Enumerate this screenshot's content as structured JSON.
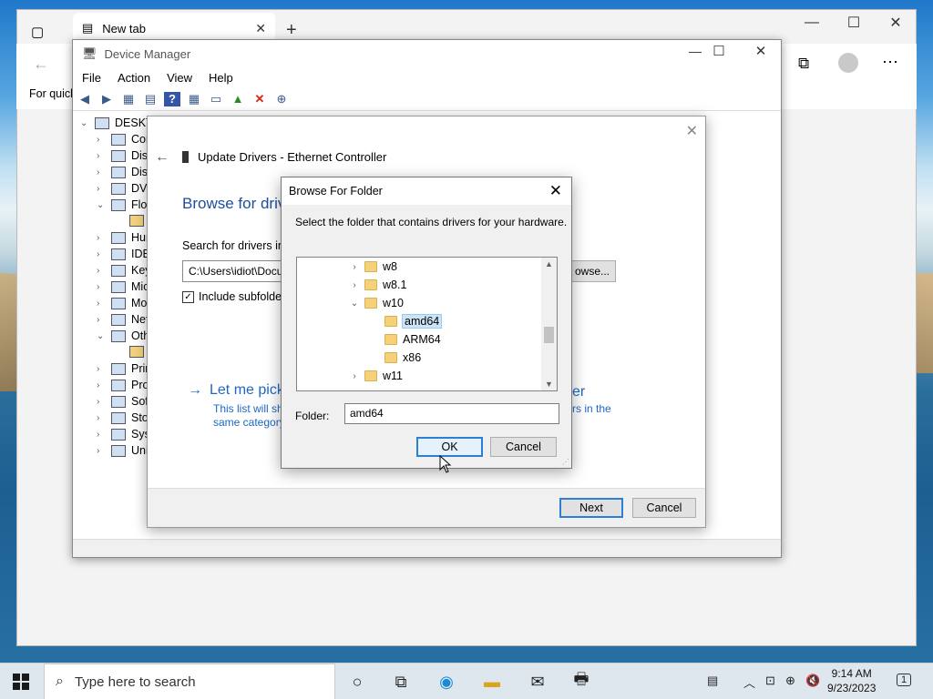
{
  "browser": {
    "tab_title": "New tab",
    "side_text": "For quick"
  },
  "device_manager": {
    "title": "Device Manager",
    "menu": [
      "File",
      "Action",
      "View",
      "Help"
    ],
    "root": "DESKTO",
    "items": [
      "Cor",
      "Disk",
      "Disp",
      "DVD",
      "Flop",
      "",
      "Hun",
      "IDE",
      "Key",
      "Mic",
      "Mo",
      "Net",
      "Oth",
      "",
      "Prir",
      "Pro",
      "Soft",
      "Stor",
      "Syst",
      "Uni"
    ]
  },
  "update_drivers": {
    "title": "Update Drivers - Ethernet Controller",
    "browse_heading": "Browse for drive",
    "search_label": "Search for drivers in t",
    "path_value": "C:\\Users\\idiot\\Docu",
    "browse_button": "owse...",
    "include_subfolders": "Include subfolder",
    "let_me_pick": "Let me pick",
    "let_me_pick_right": "er",
    "desc_line1": "This list will sh",
    "desc_line2": "same category",
    "desc_right": "rs in the",
    "next_button": "Next",
    "cancel_button": "Cancel"
  },
  "browse_folder": {
    "title": "Browse For Folder",
    "description": "Select the folder that contains drivers for your hardware.",
    "tree": [
      {
        "label": "w8",
        "chevron": "›"
      },
      {
        "label": "w8.1",
        "chevron": "›"
      },
      {
        "label": "w10",
        "chevron": "⌄"
      },
      {
        "label": "amd64",
        "chevron": "",
        "selected": true
      },
      {
        "label": "ARM64",
        "chevron": ""
      },
      {
        "label": "x86",
        "chevron": ""
      },
      {
        "label": "w11",
        "chevron": "›"
      }
    ],
    "folder_label": "Folder:",
    "folder_value": "amd64",
    "ok_button": "OK",
    "cancel_button": "Cancel"
  },
  "taskbar": {
    "search_placeholder": "Type here to search",
    "time": "9:14 AM",
    "date": "9/23/2023",
    "notification_count": "1"
  }
}
